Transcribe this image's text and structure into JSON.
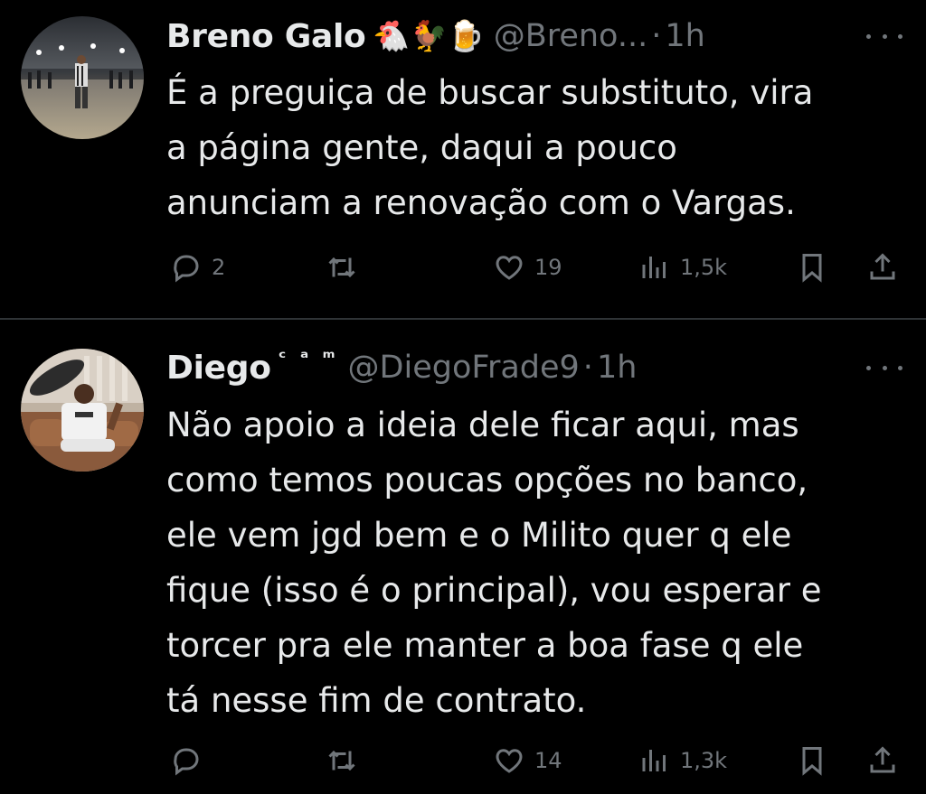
{
  "tweets": [
    {
      "author": "Breno Galo",
      "emoji": "🐔🐓🍺",
      "handle": "@Breno...",
      "time": "1h",
      "text_lines": [
        "É a preguiça de buscar substituto, vira",
        "a página gente, daqui a pouco",
        "anunciam a renovação com o Vargas."
      ],
      "replies": "2",
      "retweets": "",
      "likes": "19",
      "views": "1,5k"
    },
    {
      "author": "Diego",
      "name_superscript": "ᶜ ᵃ ᵐ",
      "handle": "@DiegoFrade9",
      "time": "1h",
      "text_lines": [
        "Não apoio a ideia dele ficar aqui, mas",
        "como temos poucas opções no banco,",
        "ele vem jgd bem e o Milito quer q ele",
        "fique (isso é o principal), vou esperar e",
        "torcer pra ele manter a boa fase q ele",
        "tá nesse fim de contrato."
      ],
      "replies": "",
      "retweets": "",
      "likes": "14",
      "views": "1,3k"
    }
  ],
  "separator": "·",
  "icons": [
    "reply-icon",
    "retweet-icon",
    "like-icon",
    "views-icon",
    "bookmark-icon",
    "share-icon",
    "more-icon"
  ],
  "colors": {
    "background": "#000000",
    "text": "#e7e9ea",
    "secondary": "#71767b",
    "divider": "#2f3336"
  }
}
